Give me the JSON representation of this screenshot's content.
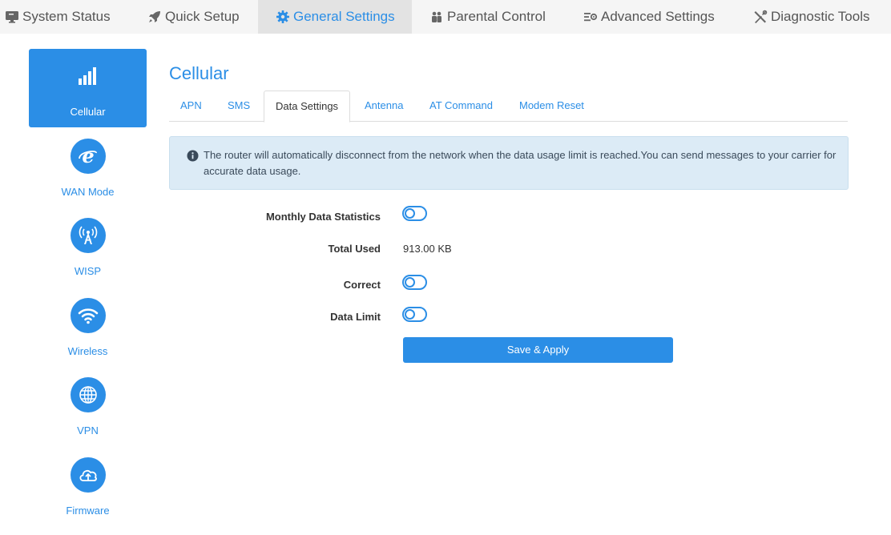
{
  "topnav": {
    "items": [
      {
        "label": "System Status",
        "icon": "monitor-icon"
      },
      {
        "label": "Quick Setup",
        "icon": "rocket-icon"
      },
      {
        "label": "General Settings",
        "icon": "gear-icon",
        "active": true
      },
      {
        "label": "Parental Control",
        "icon": "family-icon"
      },
      {
        "label": "Advanced Settings",
        "icon": "sliders-icon"
      },
      {
        "label": "Diagnostic Tools",
        "icon": "tools-icon"
      }
    ]
  },
  "sidebar": {
    "items": [
      {
        "label": "Cellular",
        "icon": "signal-bars-icon",
        "active": true
      },
      {
        "label": "WAN Mode",
        "icon": "internet-explorer-icon"
      },
      {
        "label": "WISP",
        "icon": "antenna-icon"
      },
      {
        "label": "Wireless",
        "icon": "wifi-icon"
      },
      {
        "label": "VPN",
        "icon": "globe-icon"
      },
      {
        "label": "Firmware",
        "icon": "cloud-upload-icon"
      }
    ]
  },
  "main": {
    "title": "Cellular",
    "tabs": [
      {
        "label": "APN"
      },
      {
        "label": "SMS"
      },
      {
        "label": "Data Settings",
        "active": true
      },
      {
        "label": "Antenna"
      },
      {
        "label": "AT Command"
      },
      {
        "label": "Modem Reset"
      }
    ],
    "alert": "The router will automatically disconnect from the network when the data usage limit is reached.You can send messages to your carrier for accurate data usage.",
    "form": {
      "monthly_label": "Monthly Data Statistics",
      "monthly_on": false,
      "total_used_label": "Total Used",
      "total_used_value": "913.00 KB",
      "correct_label": "Correct",
      "correct_on": false,
      "data_limit_label": "Data Limit",
      "data_limit_on": false,
      "save_label": "Save & Apply"
    }
  },
  "colors": {
    "accent": "#2b8ee6",
    "alert_bg": "#dcebf6",
    "nav_bg": "#f5f5f5",
    "nav_active_bg": "#e3e3e3"
  }
}
